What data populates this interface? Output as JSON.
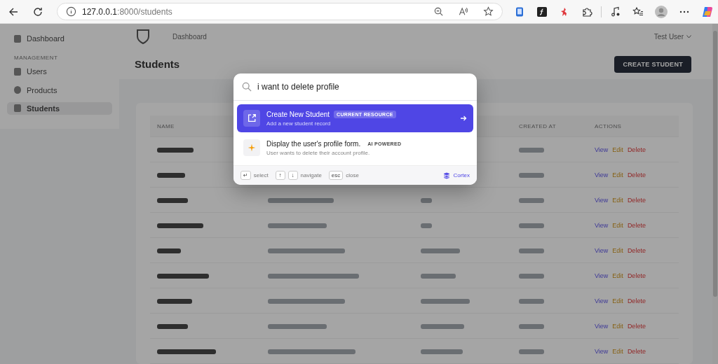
{
  "browser": {
    "url_host": "127.0.0.1",
    "url_rest": ":8000/students"
  },
  "sidebar": {
    "items": [
      {
        "label": "Dashboard",
        "selected": false
      }
    ],
    "section": "MANAGEMENT",
    "section_items": [
      {
        "label": "Users",
        "selected": false
      },
      {
        "label": "Products",
        "selected": false
      },
      {
        "label": "Students",
        "selected": true
      }
    ]
  },
  "header": {
    "breadcrumb": "Dashboard",
    "user_menu": "Test User"
  },
  "page": {
    "title": "Students",
    "create_button": "CREATE STUDENT"
  },
  "table": {
    "headers": {
      "name": "NAME",
      "created_at": "CREATED AT",
      "actions": "ACTIONS"
    },
    "rows": [
      {
        "actions": [
          "View",
          "Edit",
          "Delete"
        ]
      },
      {
        "actions": [
          "View",
          "Edit",
          "Delete"
        ]
      },
      {
        "actions": [
          "View",
          "Edit",
          "Delete"
        ]
      },
      {
        "actions": [
          "View",
          "Edit",
          "Delete"
        ]
      },
      {
        "actions": [
          "View",
          "Edit",
          "Delete"
        ]
      },
      {
        "actions": [
          "View",
          "Edit",
          "Delete"
        ]
      },
      {
        "actions": [
          "View",
          "Edit",
          "Delete"
        ]
      },
      {
        "actions": [
          "View",
          "Edit",
          "Delete"
        ]
      },
      {
        "actions": [
          "View",
          "Edit",
          "Delete"
        ]
      }
    ]
  },
  "palette": {
    "query": "i want to delete profile",
    "results": [
      {
        "kind": "resource",
        "title": "Create New Student",
        "badge": "CURRENT RESOURCE",
        "subtitle": "Add a new student record",
        "selected": true
      },
      {
        "kind": "ai",
        "title": "Display the user's profile form.",
        "badge": "AI POWERED",
        "subtitle": "User wants to delete their account profile.",
        "selected": false
      }
    ],
    "hints": [
      {
        "keys": [
          "↵"
        ],
        "label": "select"
      },
      {
        "keys": [
          "↑",
          "↓"
        ],
        "label": "navigate"
      },
      {
        "keys": [
          "esc"
        ],
        "label": "close"
      }
    ],
    "brand": "Cortex"
  }
}
